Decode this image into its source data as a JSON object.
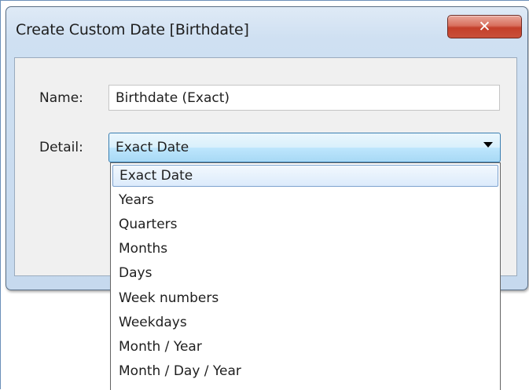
{
  "dialog": {
    "title": "Create Custom Date [Birthdate]",
    "close_icon": "close-icon",
    "name_label": "Name:",
    "name_value": "Birthdate (Exact)",
    "detail_label": "Detail:",
    "detail_value": "Exact Date"
  },
  "dropdown": {
    "options": [
      "Exact Date",
      "Years",
      "Quarters",
      "Months",
      "Days",
      "Week numbers",
      "Weekdays",
      "Month / Year",
      "Month / Day / Year"
    ],
    "selected": "Exact Date"
  },
  "colors": {
    "close_button": "#c43f2a",
    "select_border": "#3c7fb1",
    "highlight": "#dcebfc"
  }
}
